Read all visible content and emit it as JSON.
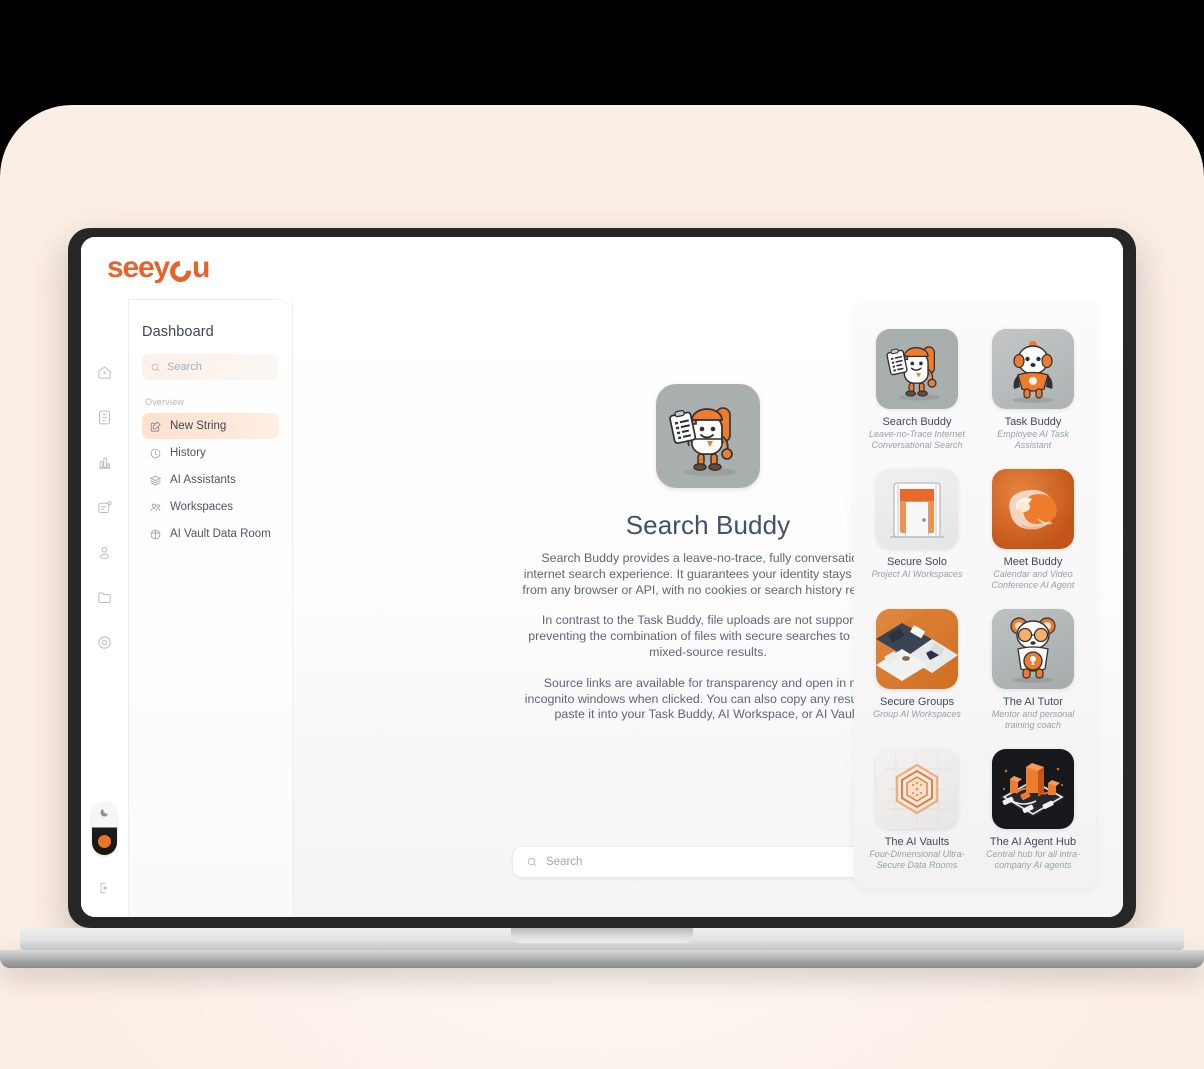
{
  "brand": {
    "name": "seeyou",
    "accent": "#e8622a"
  },
  "rail": {
    "icons": [
      "home-icon",
      "document-icon",
      "analytics-icon",
      "notes-icon",
      "user-icon",
      "folder-icon",
      "target-icon"
    ],
    "theme_toggle": {
      "light_icon": "moon-icon",
      "state": "dark"
    },
    "logout": "logout-icon"
  },
  "sidebar": {
    "title": "Dashboard",
    "search_placeholder": "Search",
    "group_label": "Overview",
    "items": [
      {
        "label": "New String",
        "icon": "edit-square-icon",
        "active": true
      },
      {
        "label": "History",
        "icon": "clock-icon",
        "active": false
      },
      {
        "label": "AI Assistants",
        "icon": "layers-icon",
        "active": false
      },
      {
        "label": "Workspaces",
        "icon": "people-icon",
        "active": false
      },
      {
        "label": "AI Vault Data Room",
        "icon": "globe-shield-icon",
        "active": false
      }
    ]
  },
  "main": {
    "avatar_name": "search-buddy-mascot",
    "title": "Search Buddy",
    "paragraphs": [
      "Search Buddy provides a leave-no-trace, fully conversational internet search experience. It guarantees your identity stays hidden from any browser or API, with no cookies or search history retained.",
      "In contrast to the Task Buddy, file uploads are not supported, preventing the combination of files with secure searches to create mixed-source results.",
      "Source links are available for transparency and open in new incognito windows when clicked. You can also copy any result, and paste it into your Task Buddy, AI Workspace, or AI Vault."
    ],
    "search_placeholder": "Search"
  },
  "apps": [
    {
      "name": "Search Buddy",
      "desc": "Leave-no-Trace Internet Conversational Search",
      "thumb": "search-buddy-thumb",
      "bg": "#a9aeaf"
    },
    {
      "name": "Task Buddy",
      "desc": "Employee AI Task Assistant",
      "thumb": "task-buddy-thumb",
      "bg": "#b4b7b8"
    },
    {
      "name": "Secure Solo",
      "desc": "Project AI Workspaces",
      "thumb": "secure-solo-thumb",
      "bg": "#e9eaea"
    },
    {
      "name": "Meet Buddy",
      "desc": "Calendar and Video Conference AI Agent",
      "thumb": "meet-buddy-thumb",
      "bg": "#c65a1b"
    },
    {
      "name": "Secure Groups",
      "desc": "Group AI Workspaces",
      "thumb": "secure-groups-thumb",
      "bg": "#d97a2e"
    },
    {
      "name": "The AI Tutor",
      "desc": "Mentor and personal training coach",
      "thumb": "ai-tutor-thumb",
      "bg": "#a9aeaf"
    },
    {
      "name": "The AI Vaults",
      "desc": "Four-Dimensional Ultra-Secure Data Rooms",
      "thumb": "ai-vaults-thumb",
      "bg": "#eeeded"
    },
    {
      "name": "The AI Agent Hub",
      "desc": "Central hub for all intra-company AI agents",
      "thumb": "ai-agent-hub-thumb",
      "bg": "#16181b"
    }
  ]
}
